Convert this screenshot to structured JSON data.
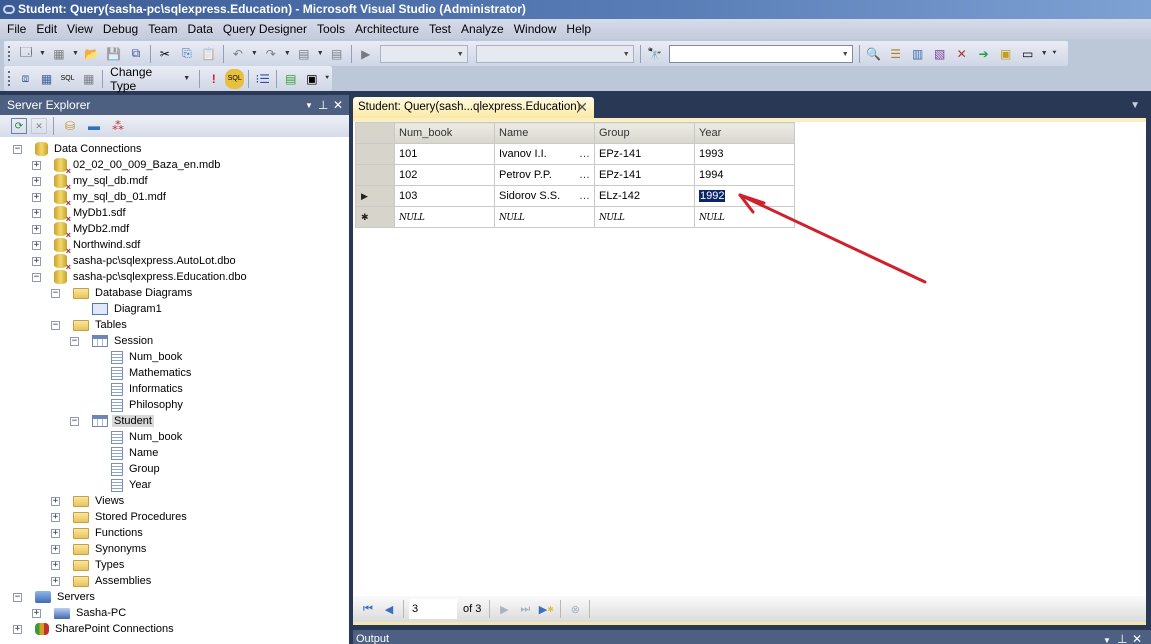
{
  "window": {
    "title": "Student: Query(sasha-pc\\sqlexpress.Education) - Microsoft Visual Studio (Administrator)"
  },
  "menu": [
    "File",
    "Edit",
    "View",
    "Debug",
    "Team",
    "Data",
    "Query Designer",
    "Tools",
    "Architecture",
    "Test",
    "Analyze",
    "Window",
    "Help"
  ],
  "toolbar": {
    "change_type_label": "Change Type",
    "find_combo_value": ""
  },
  "server_explorer": {
    "title": "Server Explorer",
    "tree": [
      {
        "label": "Data Connections",
        "level": 0,
        "expander": "minus",
        "icon": "db"
      },
      {
        "label": "02_02_00_009_Baza_en.mdb",
        "level": 1,
        "expander": "plus",
        "icon": "dbx"
      },
      {
        "label": "my_sql_db.mdf",
        "level": 1,
        "expander": "plus",
        "icon": "dbx"
      },
      {
        "label": "my_sql_db_01.mdf",
        "level": 1,
        "expander": "plus",
        "icon": "dbx"
      },
      {
        "label": "MyDb1.sdf",
        "level": 1,
        "expander": "plus",
        "icon": "dbx"
      },
      {
        "label": "MyDb2.mdf",
        "level": 1,
        "expander": "plus",
        "icon": "dbx"
      },
      {
        "label": "Northwind.sdf",
        "level": 1,
        "expander": "plus",
        "icon": "dbx"
      },
      {
        "label": "sasha-pc\\sqlexpress.AutoLot.dbo",
        "level": 1,
        "expander": "plus",
        "icon": "dbx"
      },
      {
        "label": "sasha-pc\\sqlexpress.Education.dbo",
        "level": 1,
        "expander": "minus",
        "icon": "db"
      },
      {
        "label": "Database Diagrams",
        "level": 2,
        "expander": "minus",
        "icon": "folder"
      },
      {
        "label": "Diagram1",
        "level": 3,
        "expander": "",
        "icon": "diag"
      },
      {
        "label": "Tables",
        "level": 2,
        "expander": "minus",
        "icon": "folder"
      },
      {
        "label": "Session",
        "level": 3,
        "expander": "minus",
        "icon": "table"
      },
      {
        "label": "Num_book",
        "level": 4,
        "expander": "",
        "icon": "col"
      },
      {
        "label": "Mathematics",
        "level": 4,
        "expander": "",
        "icon": "col"
      },
      {
        "label": "Informatics",
        "level": 4,
        "expander": "",
        "icon": "col"
      },
      {
        "label": "Philosophy",
        "level": 4,
        "expander": "",
        "icon": "col"
      },
      {
        "label": "Student",
        "level": 3,
        "expander": "minus",
        "icon": "table",
        "selected": true
      },
      {
        "label": "Num_book",
        "level": 4,
        "expander": "",
        "icon": "col"
      },
      {
        "label": "Name",
        "level": 4,
        "expander": "",
        "icon": "col"
      },
      {
        "label": "Group",
        "level": 4,
        "expander": "",
        "icon": "col"
      },
      {
        "label": "Year",
        "level": 4,
        "expander": "",
        "icon": "col"
      },
      {
        "label": "Views",
        "level": 2,
        "expander": "plus",
        "icon": "folder"
      },
      {
        "label": "Stored Procedures",
        "level": 2,
        "expander": "plus",
        "icon": "folder"
      },
      {
        "label": "Functions",
        "level": 2,
        "expander": "plus",
        "icon": "folder"
      },
      {
        "label": "Synonyms",
        "level": 2,
        "expander": "plus",
        "icon": "folder"
      },
      {
        "label": "Types",
        "level": 2,
        "expander": "plus",
        "icon": "folder"
      },
      {
        "label": "Assemblies",
        "level": 2,
        "expander": "plus",
        "icon": "folder"
      },
      {
        "label": "Servers",
        "level": 0,
        "expander": "minus",
        "icon": "server"
      },
      {
        "label": "Sasha-PC",
        "level": 1,
        "expander": "plus",
        "icon": "pc"
      },
      {
        "label": "SharePoint Connections",
        "level": 0,
        "expander": "plus",
        "icon": "sp"
      }
    ]
  },
  "document": {
    "tab_label": "Student: Query(sash...qlexpress.Education)",
    "grid": {
      "columns": [
        "Num_book",
        "Name",
        "Group",
        "Year"
      ],
      "rows": [
        {
          "marker": "",
          "cells": [
            "101",
            "Ivanov I.I.",
            "EPz-141",
            "1993"
          ],
          "ellipsis": true
        },
        {
          "marker": "",
          "cells": [
            "102",
            "Petrov P.P.",
            "EPz-141",
            "1994"
          ],
          "ellipsis": true
        },
        {
          "marker": "current",
          "cells": [
            "103",
            "Sidorov S.S.",
            "ELz-142",
            "1992"
          ],
          "ellipsis": true,
          "selected_col": 3
        },
        {
          "marker": "new",
          "cells": [
            "NULL",
            "NULL",
            "NULL",
            "NULL"
          ],
          "ellipsis": false,
          "null": true
        }
      ]
    },
    "navigator": {
      "current_record": "3",
      "of_label": "of 3"
    }
  },
  "output_panel": {
    "title": "Output"
  },
  "annotation": {
    "arrow_color": "#d0202a"
  }
}
